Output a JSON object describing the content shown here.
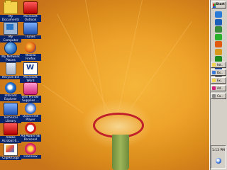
{
  "desktop": {
    "icons": [
      {
        "id": "my-documents",
        "label": "My Documents",
        "icon": "folder-icon"
      },
      {
        "id": "microsoft-outlook",
        "label": "Microsoft Outlook",
        "icon": "envelope-icon"
      },
      {
        "id": "my-computer",
        "label": "My Computer",
        "icon": "computer-icon"
      },
      {
        "id": "itunes",
        "label": "iTunes",
        "icon": "music-note-icon"
      },
      {
        "id": "my-network-places",
        "label": "My Network Places",
        "icon": "network-icon"
      },
      {
        "id": "mozilla-firefox",
        "label": "Mozilla Firefox",
        "icon": "firefox-icon"
      },
      {
        "id": "recycle-bin",
        "label": "Recycle Bin",
        "icon": "recycle-bin-icon"
      },
      {
        "id": "microsoft-word",
        "label": "Microsoft Word",
        "icon": "word-icon"
      },
      {
        "id": "internet-explorer",
        "label": "Internet Explorer",
        "icon": "internet-explorer-icon"
      },
      {
        "id": "dell-printer-supplies",
        "label": "Dell Printer Supplies ...",
        "icon": "printer-icon"
      },
      {
        "id": "technical-library",
        "label": "Technical Library",
        "icon": "book-icon"
      },
      {
        "id": "quicktime-player",
        "label": "QuickTime Player",
        "icon": "quicktime-icon"
      },
      {
        "id": "adobe-acrobat",
        "label": "Adobe Acrobat 6...",
        "icon": "acrobat-icon"
      },
      {
        "id": "ad-aware",
        "label": "Ad-Aware SE Personal",
        "icon": "ad-aware-icon"
      },
      {
        "id": "cliparcopi",
        "label": "ClipArtcopi",
        "icon": "clipart-icon"
      },
      {
        "id": "freeview",
        "label": "FreeView",
        "icon": "flower-icon"
      }
    ]
  },
  "taskbar": {
    "start_label": "Start",
    "quick_launch": [
      {
        "icon": "internet-explorer-icon",
        "color": "#2a7ad8"
      },
      {
        "icon": "outlook-icon",
        "color": "#1b5fb8"
      },
      {
        "icon": "desktop-icon",
        "color": "#3a8a3a"
      },
      {
        "icon": "messenger-icon",
        "color": "#2ab02a"
      },
      {
        "icon": "firefox-icon",
        "color": "#e05a10"
      },
      {
        "icon": "winamp-icon",
        "color": "#d89a1a"
      },
      {
        "icon": "shield-icon",
        "color": "#1e8a1e"
      },
      {
        "icon": "word-icon",
        "color": "#1b3f8f"
      },
      {
        "icon": "printer-icon",
        "color": "#6a6a6a"
      }
    ],
    "tasks": [
      {
        "label": "htt..",
        "icon": "folder-icon",
        "color": "#f2d34b"
      },
      {
        "label": "Do..",
        "icon": "document-icon",
        "color": "#3a7ad8"
      },
      {
        "label": "Ex..",
        "icon": "folder-icon",
        "color": "#f2d34b"
      },
      {
        "label": "Ad..",
        "icon": "ad-aware-icon",
        "color": "#d2257a"
      },
      {
        "label": "Ca..",
        "icon": "calculator-icon",
        "color": "#888888"
      }
    ],
    "clock": "1:13 PM"
  }
}
